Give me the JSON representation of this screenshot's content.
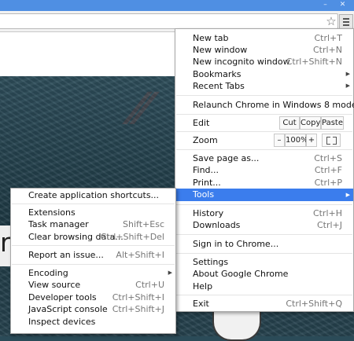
{
  "browser": {
    "icons": {
      "star": "star-icon",
      "menu": "hamburger-menu-icon",
      "minimize": "minimize-icon",
      "close": "close-icon"
    },
    "window_glyphs": {
      "minimize": "–",
      "close": "✕"
    },
    "star_glyph": "☆"
  },
  "page": {
    "hero_text": "rity"
  },
  "main_menu": {
    "items": [
      {
        "label": "New tab",
        "shortcut": "Ctrl+T"
      },
      {
        "label": "New window",
        "shortcut": "Ctrl+N"
      },
      {
        "label": "New incognito window",
        "shortcut": "Ctrl+Shift+N"
      },
      {
        "label": "Bookmarks",
        "arrow": "▶"
      },
      {
        "label": "Recent Tabs",
        "arrow": "▶"
      },
      {
        "label": "Relaunch Chrome in Windows 8 mode"
      },
      {
        "label": "Edit"
      },
      {
        "label": "Zoom"
      },
      {
        "label": "Save page as...",
        "shortcut": "Ctrl+S"
      },
      {
        "label": "Find...",
        "shortcut": "Ctrl+F"
      },
      {
        "label": "Print...",
        "shortcut": "Ctrl+P"
      },
      {
        "label": "Tools",
        "arrow": "▶"
      },
      {
        "label": "History",
        "shortcut": "Ctrl+H"
      },
      {
        "label": "Downloads",
        "shortcut": "Ctrl+J"
      },
      {
        "label": "Sign in to Chrome..."
      },
      {
        "label": "Settings"
      },
      {
        "label": "About Google Chrome"
      },
      {
        "label": "Help"
      },
      {
        "label": "Exit",
        "shortcut": "Ctrl+Shift+Q"
      }
    ],
    "edit_buttons": {
      "cut": "Cut",
      "copy": "Copy",
      "paste": "Paste"
    },
    "zoom": {
      "minus": "–",
      "value": "100%",
      "plus": "+"
    }
  },
  "tools_submenu": {
    "items": [
      {
        "label": "Create application shortcuts..."
      },
      {
        "label": "Extensions"
      },
      {
        "label": "Task manager",
        "shortcut": "Shift+Esc"
      },
      {
        "label": "Clear browsing data...",
        "shortcut": "Ctrl+Shift+Del"
      },
      {
        "label": "Report an issue...",
        "shortcut": "Alt+Shift+I"
      },
      {
        "label": "Encoding",
        "arrow": "▶"
      },
      {
        "label": "View source",
        "shortcut": "Ctrl+U"
      },
      {
        "label": "Developer tools",
        "shortcut": "Ctrl+Shift+I"
      },
      {
        "label": "JavaScript console",
        "shortcut": "Ctrl+Shift+J"
      },
      {
        "label": "Inspect devices"
      }
    ]
  },
  "colors": {
    "highlight": "#3b7ded",
    "title_bar": "#4f8fe3"
  }
}
